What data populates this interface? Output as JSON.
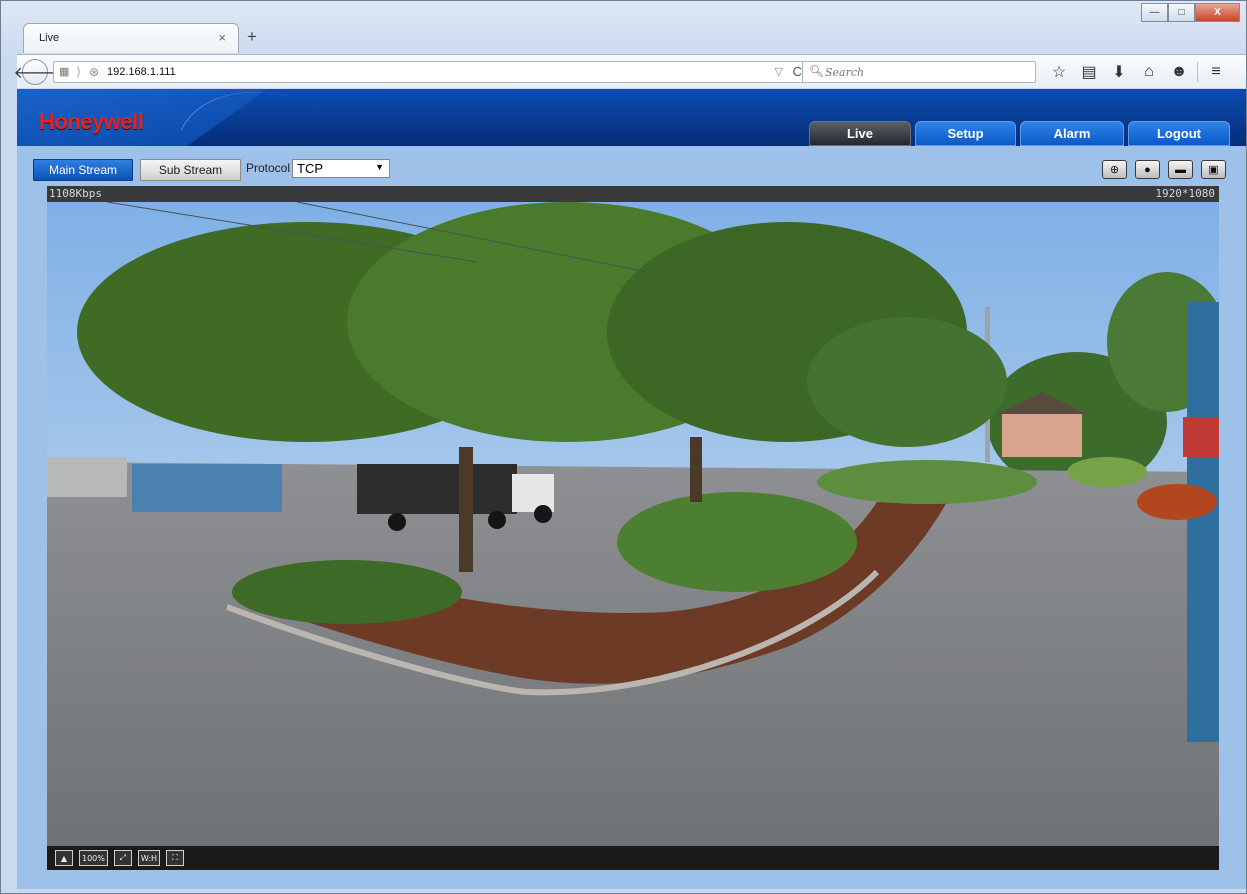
{
  "browser": {
    "tab_title": "Live",
    "tab_close": "×",
    "new_tab": "+",
    "url": "192.168.1.111",
    "search_placeholder": "Search",
    "window_buttons": {
      "minimize": "—",
      "maximize": "□",
      "close": "X"
    },
    "icons": {
      "back": "back-arrow-icon",
      "page": "page-icon",
      "globe": "globe-icon",
      "reload": "reload-icon",
      "search": "search-icon",
      "toolbar": [
        "bookmark-star-icon",
        "clipboard-icon",
        "download-icon",
        "home-icon",
        "chat-icon",
        "menu-icon"
      ]
    },
    "glyphs": {
      "back": "🡐",
      "page": "▦",
      "sep": "⟩",
      "globe": "⊛",
      "drop": "▽",
      "reload": "C",
      "search": "🔍︎",
      "star": "☆",
      "clipboard": "▤",
      "download": "⬇",
      "home": "⌂",
      "chat": "☻",
      "menu": "≡"
    }
  },
  "app": {
    "logo": "Honeywell",
    "nav": [
      "Live",
      "Setup",
      "Alarm",
      "Logout"
    ],
    "active_nav": "Live",
    "brand_color": "#e4231e",
    "header_color": "#0b47a7",
    "stream": {
      "main_label": "Main Stream",
      "sub_label": "Sub Stream",
      "active": "Main Stream",
      "protocol_label": "Protocol",
      "protocol_value": "TCP",
      "caret": "▼"
    },
    "live_tools": [
      {
        "name": "zoom-icon",
        "glyph": "⊕"
      },
      {
        "name": "snapshot-icon",
        "glyph": "●"
      },
      {
        "name": "image-icon",
        "glyph": "▬"
      },
      {
        "name": "record-icon",
        "glyph": "▣"
      }
    ],
    "video": {
      "bitrate": "1108Kbps",
      "resolution": "1920*1080",
      "bottom_tools": [
        {
          "name": "aspect-icon",
          "text": "▲"
        },
        {
          "name": "scale-100-button",
          "text": "100%"
        },
        {
          "name": "fit-window-icon",
          "text": "⤢"
        },
        {
          "name": "wh-ratio-button",
          "text": "W:H"
        },
        {
          "name": "fullscreen-icon",
          "text": "⛶"
        }
      ]
    }
  }
}
